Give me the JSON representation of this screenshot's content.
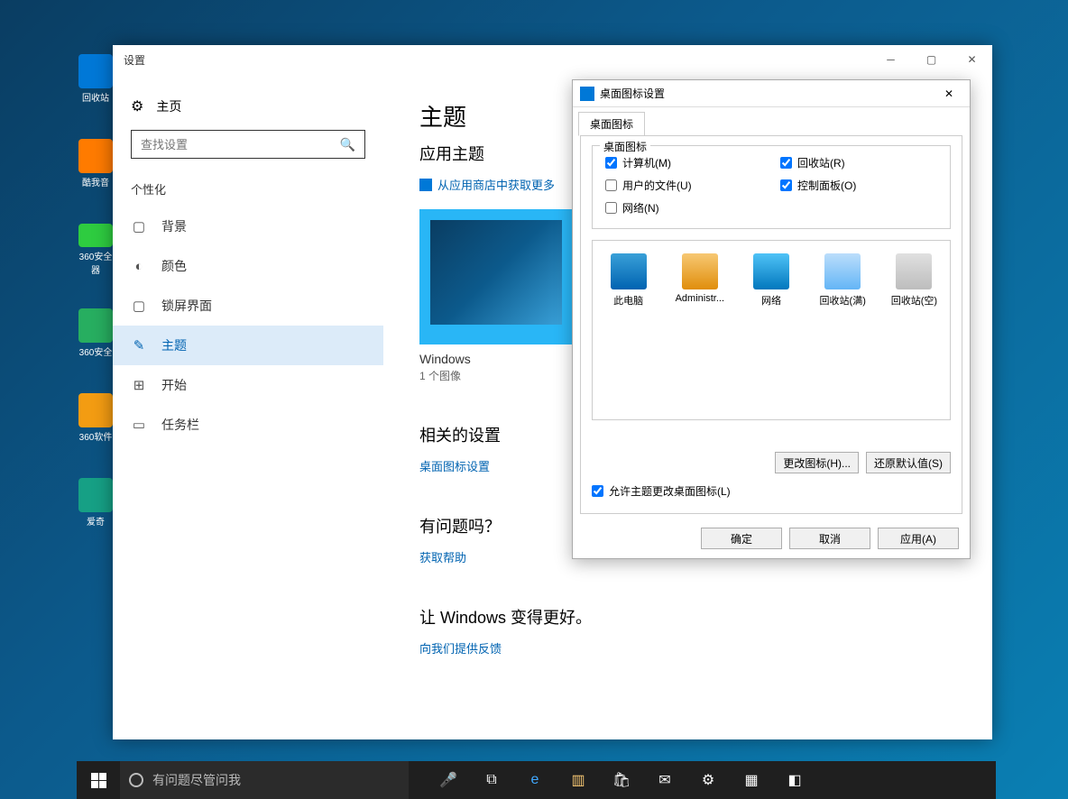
{
  "desktop_icons": [
    "回收站",
    "酷我音",
    "360安全 器",
    "360安全",
    "360软件",
    "爱奇"
  ],
  "settings": {
    "window_title": "设置",
    "home_label": "主页",
    "search_placeholder": "查找设置",
    "section_label": "个性化",
    "nav": [
      {
        "icon": "▢",
        "label": "背景"
      },
      {
        "icon": "◐",
        "label": "颜色"
      },
      {
        "icon": "▢",
        "label": "锁屏界面"
      },
      {
        "icon": "✎",
        "label": "主题"
      },
      {
        "icon": "⊞",
        "label": "开始"
      },
      {
        "icon": "▭",
        "label": "任务栏"
      }
    ],
    "main": {
      "title": "主题",
      "subtitle": "应用主题",
      "store_link": "从应用商店中获取更多",
      "theme_name": "Windows",
      "theme_sub": "1 个图像",
      "related_heading": "相关的设置",
      "related_link": "桌面图标设置",
      "help_heading": "有问题吗？",
      "help_link": "获取帮助",
      "better_heading": "让 Windows 变得更好。",
      "better_link": "向我们提供反馈"
    }
  },
  "dialog": {
    "title": "桌面图标设置",
    "tab": "桌面图标",
    "fieldset_legend": "桌面图标",
    "checks": [
      {
        "label": "计算机(M)",
        "checked": true
      },
      {
        "label": "回收站(R)",
        "checked": true
      },
      {
        "label": "用户的文件(U)",
        "checked": false
      },
      {
        "label": "控制面板(O)",
        "checked": true
      },
      {
        "label": "网络(N)",
        "checked": false
      }
    ],
    "icons": [
      "此电脑",
      "Administr...",
      "网络",
      "回收站(满)",
      "回收站(空)"
    ],
    "change_icon_btn": "更改图标(H)...",
    "restore_btn": "还原默认值(S)",
    "allow_theme": "允许主题更改桌面图标(L)",
    "ok": "确定",
    "cancel": "取消",
    "apply": "应用(A)"
  },
  "taskbar": {
    "search_placeholder": "有问题尽管问我"
  }
}
